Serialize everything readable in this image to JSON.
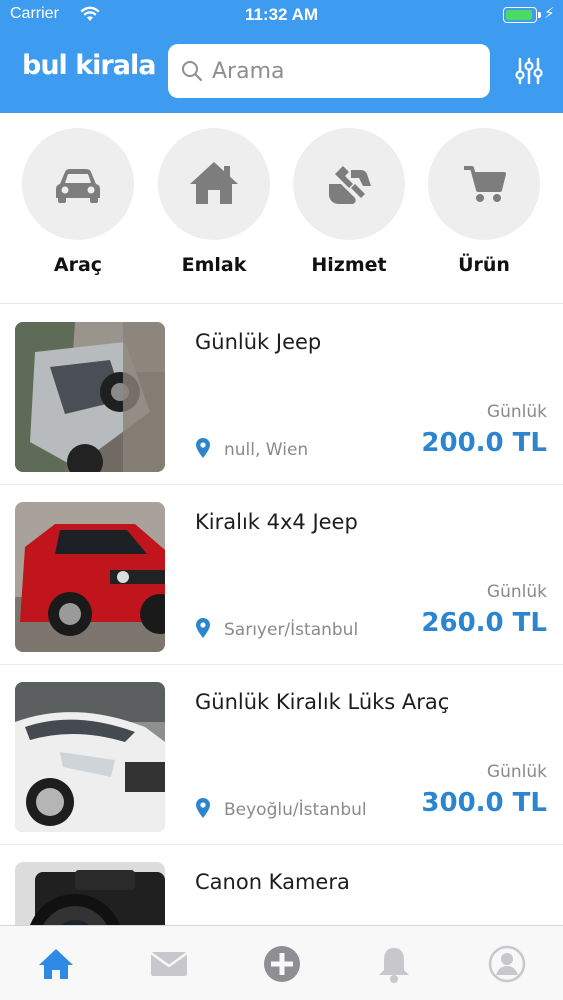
{
  "status_bar": {
    "carrier": "Carrier",
    "time": "11:32 AM"
  },
  "header": {
    "logo": "bul kirala",
    "search_placeholder": "Arama"
  },
  "categories": [
    {
      "label": "Araç",
      "icon": "car-icon"
    },
    {
      "label": "Emlak",
      "icon": "home-icon"
    },
    {
      "label": "Hizmet",
      "icon": "handshake-icon"
    },
    {
      "label": "Ürün",
      "icon": "cart-icon"
    }
  ],
  "listings": [
    {
      "title": "Günlük Jeep",
      "location": "null, Wien",
      "period": "Günlük",
      "price": "200.0 TL"
    },
    {
      "title": "Kiralık 4x4 Jeep",
      "location": "Sarıyer/İstanbul",
      "period": "Günlük",
      "price": "260.0 TL"
    },
    {
      "title": "Günlük Kiralık Lüks Araç",
      "location": "Beyoğlu/İstanbul",
      "period": "Günlük",
      "price": "300.0 TL"
    },
    {
      "title": "Canon Kamera",
      "location": "",
      "period": "",
      "price": ""
    }
  ],
  "tabbar": {
    "active": "home",
    "items": [
      "home-icon",
      "mail-icon",
      "add-icon",
      "bell-icon",
      "profile-icon"
    ]
  },
  "colors": {
    "brand": "#3d9bf0",
    "price": "#2c86cf",
    "active_tab": "#2f8ae6",
    "inactive_tab": "#c7c7cc"
  }
}
